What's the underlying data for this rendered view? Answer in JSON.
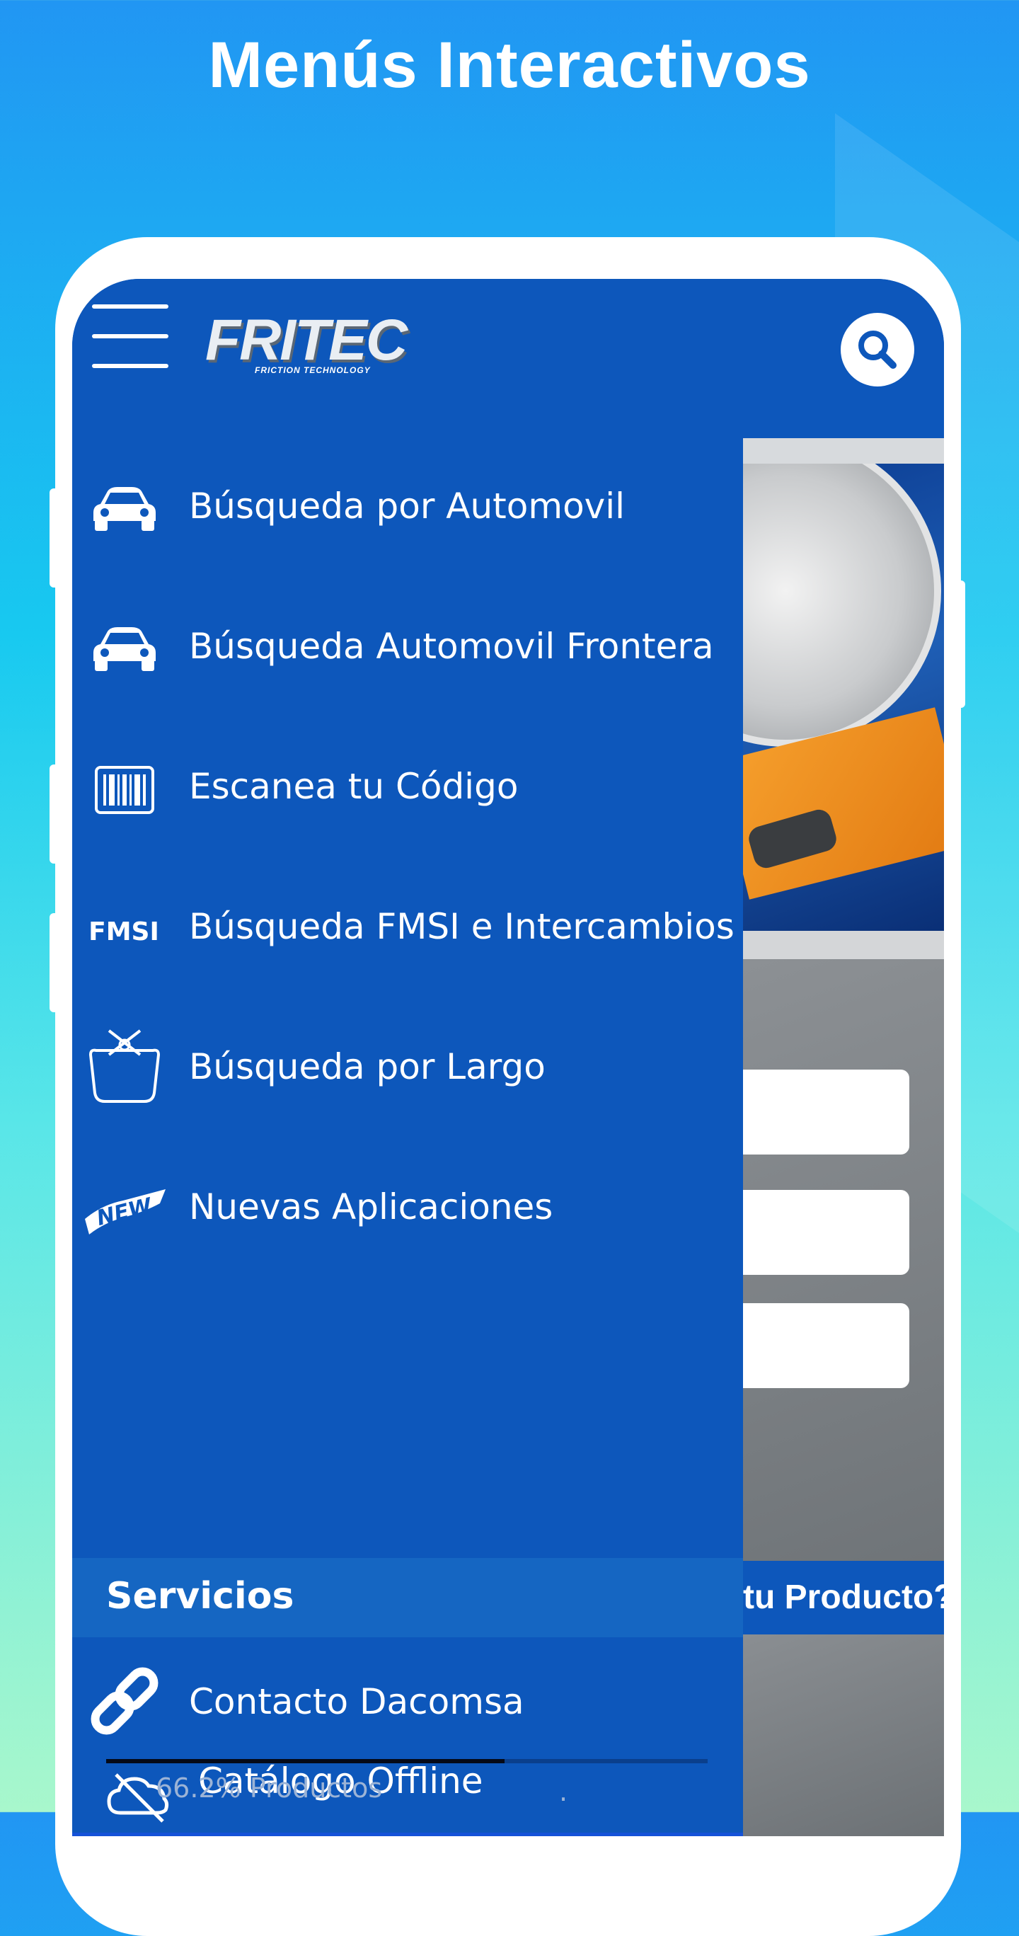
{
  "headline": "Menús Interactivos",
  "app": {
    "logo_text": "FRITEC",
    "logo_subtitle": "FRICTION TECHNOLOGY",
    "brand_color": "#0d57bb",
    "menu_icon": "hamburger-menu-icon",
    "search_icon": "search-icon"
  },
  "menu": {
    "items": [
      {
        "label": "Búsqueda por Automovil",
        "icon": "car-icon"
      },
      {
        "label": "Búsqueda Automovil Frontera",
        "icon": "car-icon"
      },
      {
        "label": "Escanea tu Código",
        "icon": "barcode-icon"
      },
      {
        "label": "Búsqueda FMSI e Intercambios",
        "icon": "fmsi-icon"
      },
      {
        "label": "Búsqueda por Largo",
        "icon": "brake-pad-measure-icon"
      },
      {
        "label": "Nuevas Aplicaciones",
        "icon": "new-badge-icon"
      }
    ],
    "section_title": "Servicios",
    "services": [
      {
        "label": "Contacto Dacomsa",
        "icon": "link-icon"
      },
      {
        "label": "Catálogo Offline",
        "icon": "cloud-off-icon"
      }
    ],
    "progress": {
      "value": 0.662,
      "label": "66.2% Productos",
      "dot": "."
    }
  },
  "background_content": {
    "banner_text": "tu Producto?"
  }
}
